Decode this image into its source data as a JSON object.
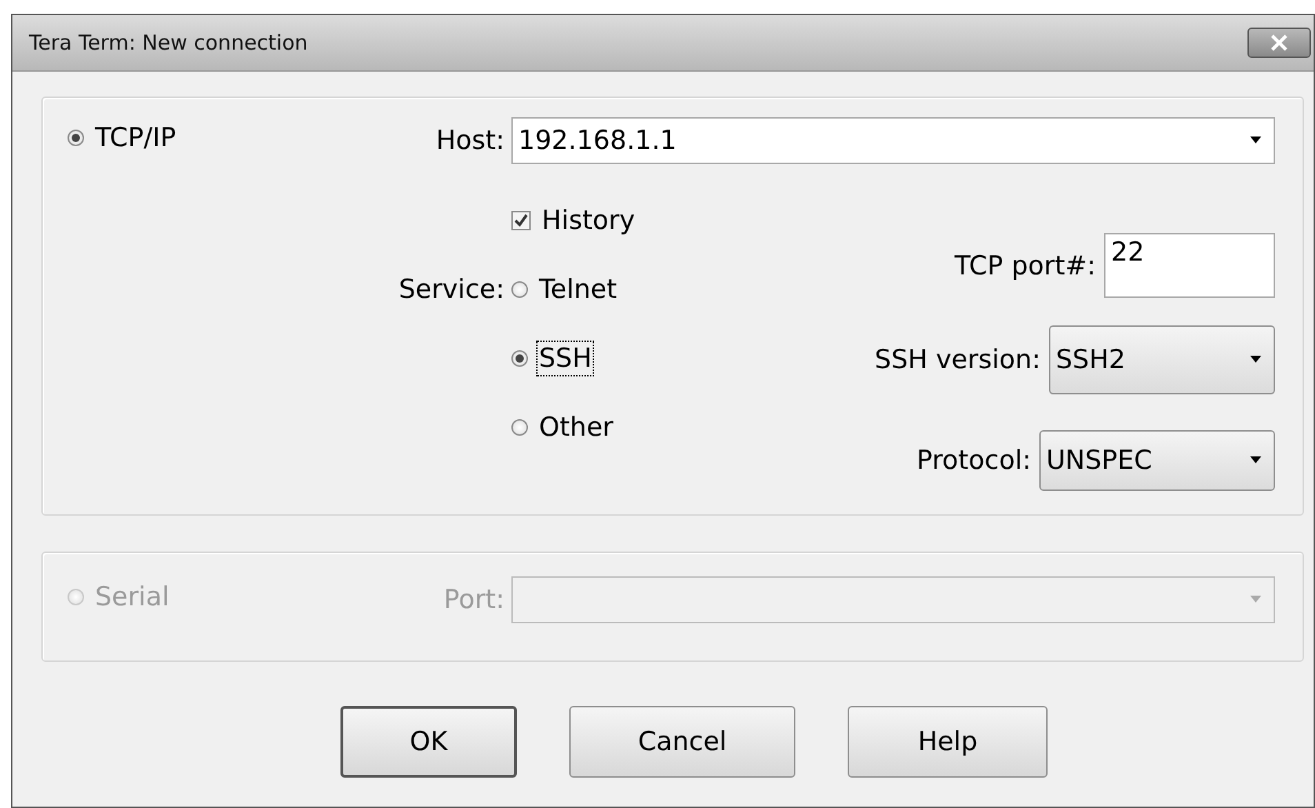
{
  "window": {
    "title": "Tera Term: New connection"
  },
  "tcpip": {
    "label": "TCP/IP",
    "selected": true,
    "disabled": false
  },
  "host": {
    "label": "Host:",
    "value": "192.168.1.1"
  },
  "history": {
    "label": "History",
    "checked": true
  },
  "service": {
    "label": "Service:",
    "options": [
      {
        "label": "Telnet",
        "selected": false,
        "focused": false
      },
      {
        "label": "SSH",
        "selected": true,
        "focused": true
      },
      {
        "label": "Other",
        "selected": false,
        "focused": false
      }
    ]
  },
  "tcp_port": {
    "label": "TCP port#:",
    "value": "22"
  },
  "ssh_version": {
    "label": "SSH version:",
    "value": "SSH2"
  },
  "protocol": {
    "label": "Protocol:",
    "value": "UNSPEC"
  },
  "serial": {
    "label": "Serial",
    "selected": false,
    "disabled": true
  },
  "port": {
    "label": "Port:",
    "disabled": true
  },
  "buttons": [
    {
      "label": "OK",
      "default": true
    },
    {
      "label": "Cancel",
      "default": false
    },
    {
      "label": "Help",
      "default": false
    }
  ]
}
